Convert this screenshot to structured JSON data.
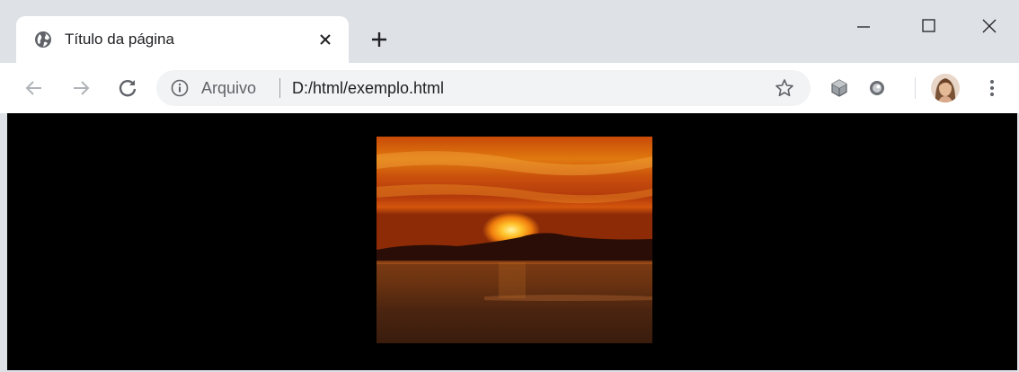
{
  "tab": {
    "title": "Título da página",
    "favicon": "globe-icon"
  },
  "window_controls": [
    "minimize-icon",
    "maximize-icon",
    "close-icon"
  ],
  "toolbar": {
    "back_icon": "back-arrow-icon",
    "forward_icon": "forward-arrow-icon",
    "reload_icon": "reload-icon"
  },
  "omnibox": {
    "security_label": "Arquivo",
    "url": "D:/html/exemplo.html",
    "security_icon": "info-icon",
    "bookmark_icon": "star-icon"
  },
  "extensions": [
    "cube-extension-icon",
    "circle-extension-icon"
  ],
  "profile": {
    "icon": "avatar"
  },
  "menu_icon": "more-vert-icon",
  "page": {
    "background": "#000000",
    "image": "sunset-over-water"
  },
  "colors": {
    "tabstrip": "#dee1e6",
    "toolbar": "#ffffff",
    "omnibox": "#f1f3f4",
    "icon": "#5f6368"
  }
}
